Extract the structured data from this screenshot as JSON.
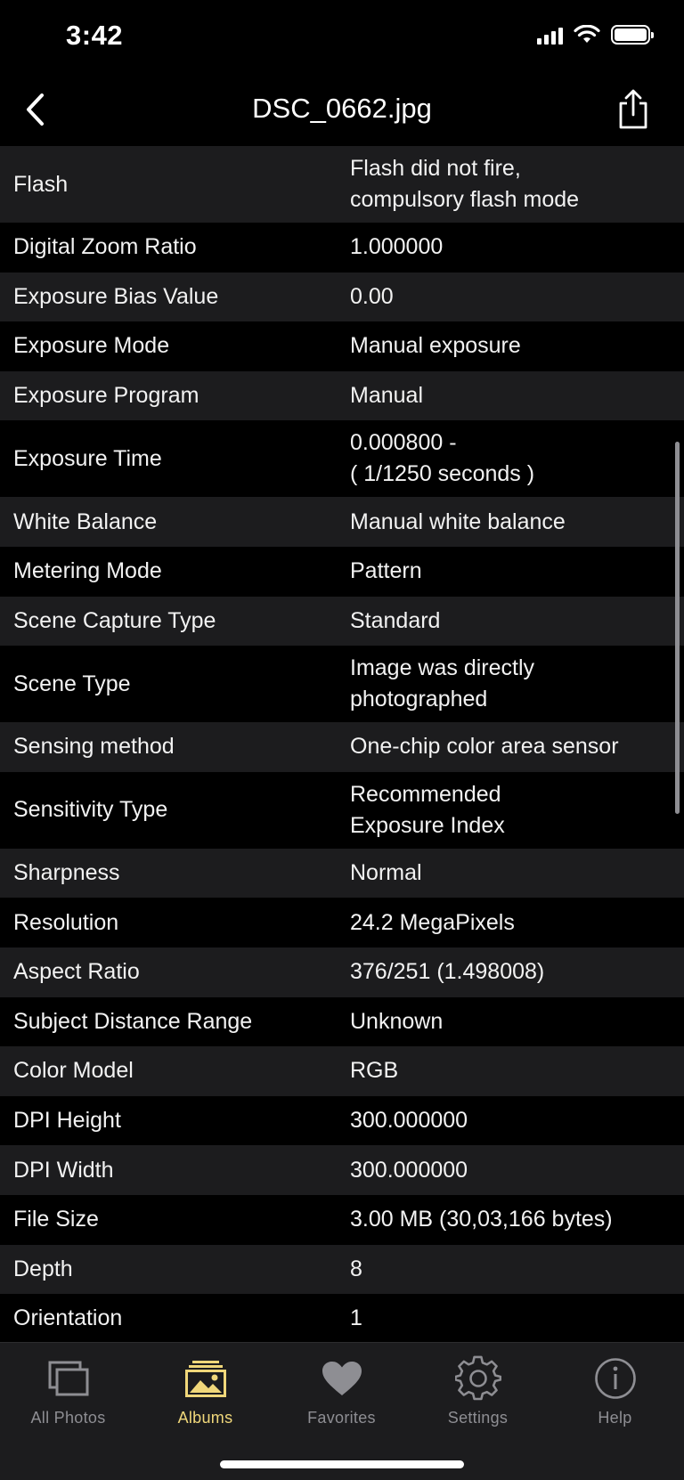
{
  "status_bar": {
    "time": "3:42"
  },
  "nav": {
    "title": "DSC_0662.jpg",
    "back_icon": "chevron-left-icon",
    "share_icon": "share-icon"
  },
  "rows": [
    {
      "key": "Flash",
      "value": "Flash did not fire,\ncompulsory flash mode"
    },
    {
      "key": "Digital Zoom Ratio",
      "value": "1.000000"
    },
    {
      "key": "Exposure Bias Value",
      "value": "0.00"
    },
    {
      "key": "Exposure Mode",
      "value": "Manual exposure"
    },
    {
      "key": "Exposure Program",
      "value": "Manual"
    },
    {
      "key": "Exposure Time",
      "value": "0.000800 -\n( 1/1250 seconds )"
    },
    {
      "key": "White Balance",
      "value": "Manual white balance"
    },
    {
      "key": "Metering Mode",
      "value": "Pattern"
    },
    {
      "key": "Scene Capture Type",
      "value": "Standard"
    },
    {
      "key": "Scene Type",
      "value": "Image was directly\nphotographed"
    },
    {
      "key": "Sensing method",
      "value": "One-chip color area sensor"
    },
    {
      "key": "Sensitivity Type",
      "value": "Recommended\nExposure Index"
    },
    {
      "key": "Sharpness",
      "value": "Normal"
    },
    {
      "key": "Resolution",
      "value": "24.2 MegaPixels"
    },
    {
      "key": "Aspect Ratio",
      "value": "376/251 (1.498008)"
    },
    {
      "key": "Subject Distance Range",
      "value": "Unknown"
    },
    {
      "key": "Color Model",
      "value": "RGB"
    },
    {
      "key": "DPI Height",
      "value": "300.000000"
    },
    {
      "key": "DPI Width",
      "value": "300.000000"
    },
    {
      "key": "File Size",
      "value": "3.00 MB (30,03,166 bytes)"
    },
    {
      "key": "Depth",
      "value": "8"
    },
    {
      "key": "Orientation",
      "value": "1"
    }
  ],
  "tabs": [
    {
      "label": "All Photos",
      "icon": "all-photos-icon",
      "active": false
    },
    {
      "label": "Albums",
      "icon": "albums-icon",
      "active": true
    },
    {
      "label": "Favorites",
      "icon": "heart-icon",
      "active": false
    },
    {
      "label": "Settings",
      "icon": "gear-icon",
      "active": false
    },
    {
      "label": "Help",
      "icon": "info-icon",
      "active": false
    }
  ],
  "colors": {
    "accent": "#f0d77a",
    "inactive": "#8e8e93",
    "row_alt": "#1c1c1e"
  }
}
